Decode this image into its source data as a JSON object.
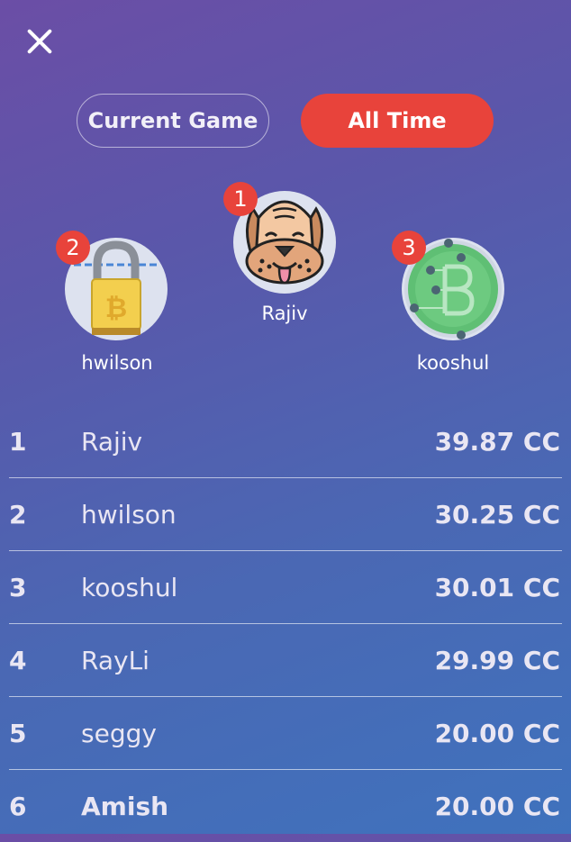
{
  "header": {
    "close_icon": "close-icon"
  },
  "tabs": [
    {
      "label": "Current Game",
      "active": false
    },
    {
      "label": "All Time",
      "active": true
    }
  ],
  "colors": {
    "accent": "#e8433b",
    "bg_start": "#6b4ea6",
    "bg_end": "#3f72bd"
  },
  "podium": {
    "first": {
      "rank": "1",
      "name": "Rajiv",
      "avatar": "dog-face-icon"
    },
    "second": {
      "rank": "2",
      "name": "hwilson",
      "avatar": "bitcoin-padlock-icon"
    },
    "third": {
      "rank": "3",
      "name": "kooshul",
      "avatar": "bitcoin-circuit-coin-icon"
    }
  },
  "leaderboard": [
    {
      "rank": "1",
      "name": "Rajiv",
      "score": "39.87 CC"
    },
    {
      "rank": "2",
      "name": "hwilson",
      "score": "30.25 CC"
    },
    {
      "rank": "3",
      "name": "kooshul",
      "score": "30.01 CC"
    },
    {
      "rank": "4",
      "name": "RayLi",
      "score": "29.99 CC"
    },
    {
      "rank": "5",
      "name": "seggy",
      "score": "20.00 CC"
    },
    {
      "rank": "6",
      "name": "Amish",
      "score": "20.00 CC"
    }
  ]
}
